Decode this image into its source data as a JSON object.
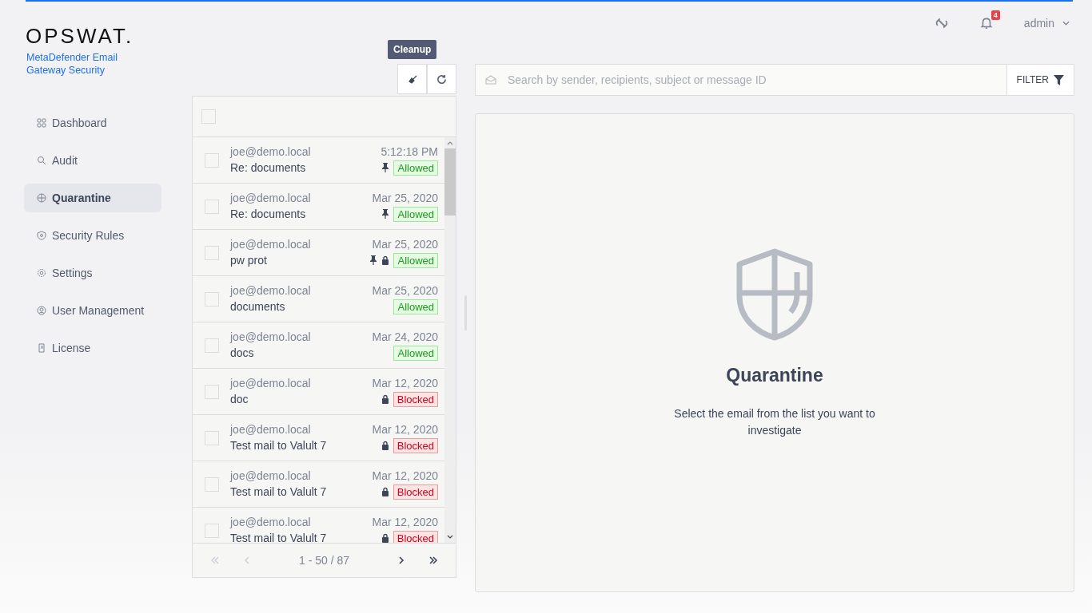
{
  "brand": {
    "logo": "OPSWAT.",
    "product": "MetaDefender Email Gateway Security"
  },
  "header": {
    "notifications": "4",
    "user": "admin"
  },
  "sidebar": {
    "items": [
      {
        "label": "Dashboard",
        "selected": false
      },
      {
        "label": "Audit",
        "selected": false
      },
      {
        "label": "Quarantine",
        "selected": true
      },
      {
        "label": "Security Rules",
        "selected": false
      },
      {
        "label": "Settings",
        "selected": false
      },
      {
        "label": "User Management",
        "selected": false
      },
      {
        "label": "License",
        "selected": false
      }
    ]
  },
  "toolbar": {
    "tooltip": "Cleanup"
  },
  "search": {
    "placeholder": "Search by sender, recipients, subject or message ID",
    "filter": "FILTER"
  },
  "select_all_checked": false,
  "emails": [
    {
      "sender": "joe@demo.local",
      "subject": "Re: documents",
      "time": "5:12:18 PM",
      "pinned": true,
      "locked": false,
      "status": "Allowed",
      "kind": "allowed",
      "checked": false
    },
    {
      "sender": "joe@demo.local",
      "subject": "Re: documents",
      "time": "Mar 25, 2020",
      "pinned": true,
      "locked": false,
      "status": "Allowed",
      "kind": "allowed",
      "checked": false
    },
    {
      "sender": "joe@demo.local",
      "subject": "pw prot",
      "time": "Mar 25, 2020",
      "pinned": true,
      "locked": true,
      "status": "Allowed",
      "kind": "allowed",
      "checked": false
    },
    {
      "sender": "joe@demo.local",
      "subject": "documents",
      "time": "Mar 25, 2020",
      "pinned": false,
      "locked": false,
      "status": "Allowed",
      "kind": "allowed",
      "checked": false
    },
    {
      "sender": "joe@demo.local",
      "subject": "docs",
      "time": "Mar 24, 2020",
      "pinned": false,
      "locked": false,
      "status": "Allowed",
      "kind": "allowed",
      "checked": false
    },
    {
      "sender": "joe@demo.local",
      "subject": "doc",
      "time": "Mar 12, 2020",
      "pinned": false,
      "locked": true,
      "status": "Blocked",
      "kind": "blocked",
      "checked": false
    },
    {
      "sender": "joe@demo.local",
      "subject": "Test mail to Valult 7",
      "time": "Mar 12, 2020",
      "pinned": false,
      "locked": true,
      "status": "Blocked",
      "kind": "blocked",
      "checked": false
    },
    {
      "sender": "joe@demo.local",
      "subject": "Test mail to Valult 7",
      "time": "Mar 12, 2020",
      "pinned": false,
      "locked": true,
      "status": "Blocked",
      "kind": "blocked",
      "checked": false
    },
    {
      "sender": "joe@demo.local",
      "subject": "Test mail to Valult 7",
      "time": "Mar 12, 2020",
      "pinned": false,
      "locked": true,
      "status": "Blocked",
      "kind": "blocked",
      "checked": false
    }
  ],
  "pagination": {
    "range": "1 - 50 / 87",
    "first_disabled": true,
    "prev_disabled": true,
    "next_disabled": false,
    "last_disabled": false
  },
  "detail": {
    "title": "Quarantine",
    "message": "Select the email from the list you want to investigate"
  }
}
